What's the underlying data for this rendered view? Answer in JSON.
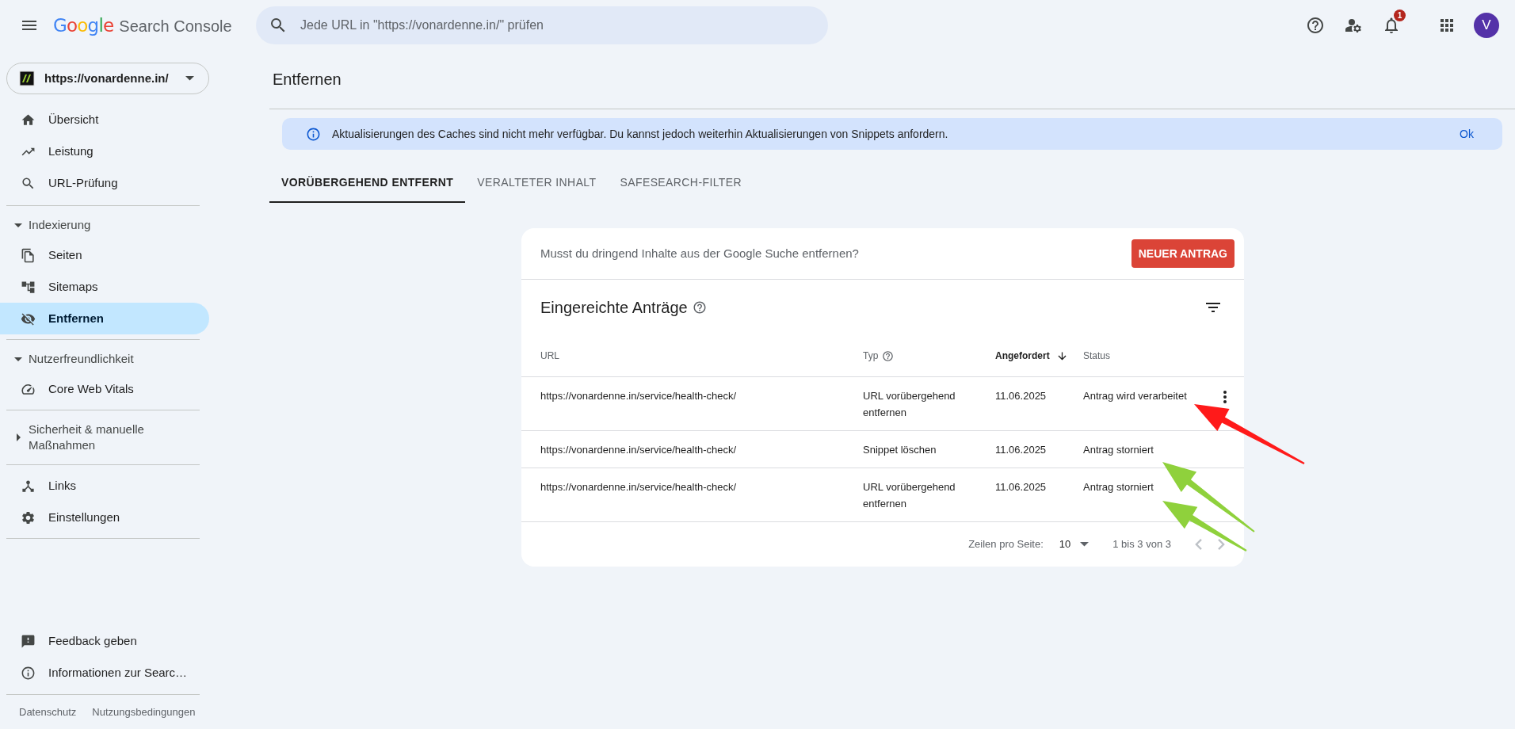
{
  "header": {
    "logo": "Google",
    "product": "Search Console",
    "search": {
      "placeholder": "Jede URL in \"https://vonardenne.in/\" prüfen"
    },
    "notification_count": "1",
    "avatar": "V"
  },
  "property": {
    "url": "https://vonardenne.in/"
  },
  "sidebar": {
    "sections": [
      {
        "items": [
          {
            "label": "Übersicht",
            "selected": false
          },
          {
            "label": "Leistung",
            "selected": false
          },
          {
            "label": "URL-Prüfung",
            "selected": false
          }
        ]
      },
      {
        "title": "Indexierung",
        "expanded": true,
        "items": [
          {
            "label": "Seiten",
            "selected": false
          },
          {
            "label": "Sitemaps",
            "selected": false
          },
          {
            "label": "Entfernen",
            "selected": true
          }
        ]
      },
      {
        "title": "Nutzerfreundlichkeit",
        "expanded": true,
        "items": [
          {
            "label": "Core Web Vitals",
            "selected": false
          }
        ]
      },
      {
        "title": "Sicherheit & manuelle Maßnahmen",
        "expanded": false
      },
      {
        "items": [
          {
            "label": "Links",
            "selected": false
          },
          {
            "label": "Einstellungen",
            "selected": false
          }
        ]
      }
    ],
    "footer_items": [
      "Feedback geben",
      "Informationen zur Searc…"
    ],
    "legal_links": [
      "Datenschutz",
      "Nutzungsbedingungen"
    ]
  },
  "main": {
    "title": "Entfernen",
    "banner": {
      "text": "Aktualisierungen des Caches sind nicht mehr verfügbar. Du kannst jedoch weiterhin Aktualisierungen von Snippets anfordern.",
      "action": "Ok"
    },
    "tabs": [
      {
        "label": "VORÜBERGEHEND ENTFERNT",
        "selected": true
      },
      {
        "label": "VERALTETER INHALT",
        "selected": false
      },
      {
        "label": "SAFESEARCH-FILTER",
        "selected": false
      }
    ],
    "card": {
      "prompt": "Musst du dringend Inhalte aus der Google Suche entfernen?",
      "button": "NEUER ANTRAG",
      "title": "Eingereichte Anträge",
      "columns": [
        {
          "label": "URL",
          "help": false,
          "sorted": false
        },
        {
          "label": "Typ",
          "help": true,
          "sorted": false
        },
        {
          "label": "Angefordert",
          "help": false,
          "sorted": true
        },
        {
          "label": "Status",
          "help": false,
          "sorted": false
        }
      ],
      "rows": [
        {
          "url": "https://vonardenne.in/service/health-check/",
          "type": "URL vorübergehend entfernen",
          "requested": "11.06.2025",
          "status": "Antrag wird verarbeitet",
          "menu_shown": true
        },
        {
          "url": "https://vonardenne.in/service/health-check/",
          "type": "Snippet löschen",
          "requested": "11.06.2025",
          "status": "Antrag storniert",
          "menu_shown": false
        },
        {
          "url": "https://vonardenne.in/service/health-check/",
          "type": "URL vorübergehend entfernen",
          "requested": "11.06.2025",
          "status": "Antrag storniert",
          "menu_shown": false
        }
      ],
      "pagination": {
        "rows_label": "Zeilen pro Seite:",
        "rows_value": "10",
        "range": "1 bis 3 von 3"
      }
    }
  },
  "annotations": [
    {
      "color": "#ff1a1a"
    },
    {
      "color": "#8fd13c"
    },
    {
      "color": "#8fd13c"
    }
  ]
}
